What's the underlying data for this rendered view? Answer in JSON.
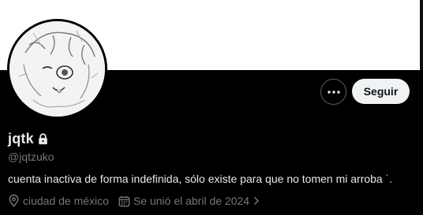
{
  "profile": {
    "display_name": "jqtk",
    "handle": "@jqtzuko",
    "bio": "cuenta inactiva de forma indefinida, sólo existe para que no tomen mi arroba ˙.",
    "location": "ciudad de méxico",
    "joined": "Se unió el abril de 2024"
  },
  "actions": {
    "follow_label": "Seguir"
  },
  "icons": {
    "more": "more-icon",
    "lock": "lock-icon",
    "location": "location-icon",
    "calendar": "calendar-icon",
    "chevron": "chevron-right-icon"
  },
  "colors": {
    "background": "#000000",
    "banner": "#ffffff",
    "text_primary": "#e7e9ea",
    "text_secondary": "#71767b",
    "button_bg": "#eff3f4",
    "button_text": "#0f1419",
    "button_border": "#536471"
  }
}
